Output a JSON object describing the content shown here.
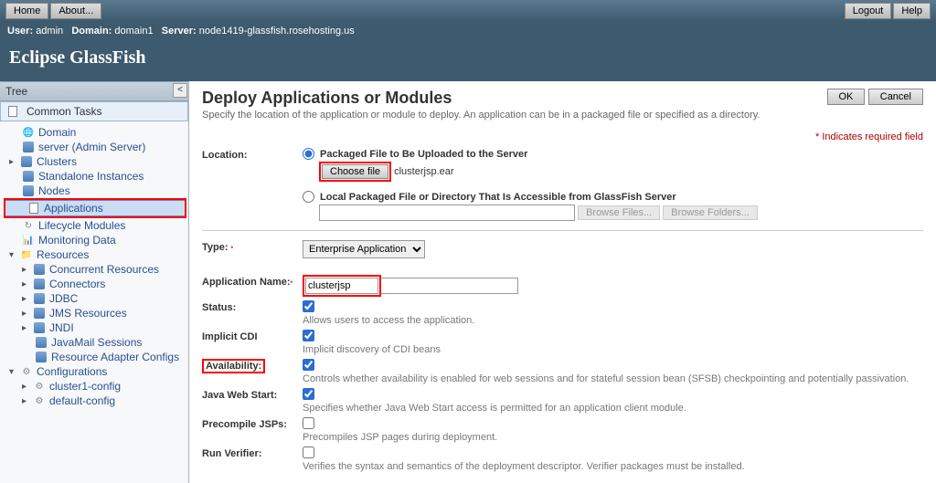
{
  "topbar": {
    "home": "Home",
    "about": "About...",
    "logout": "Logout",
    "help": "Help"
  },
  "infobar": {
    "user_lbl": "User:",
    "user_val": "admin",
    "domain_lbl": "Domain:",
    "domain_val": "domain1",
    "server_lbl": "Server:",
    "server_val": "node1419-glassfish.rosehosting.us"
  },
  "brand": "Eclipse GlassFish",
  "tree": {
    "title": "Tree",
    "common": "Common Tasks",
    "items": {
      "domain": "Domain",
      "server": "server (Admin Server)",
      "clusters": "Clusters",
      "standalone": "Standalone Instances",
      "nodes": "Nodes",
      "applications": "Applications",
      "lifecycle": "Lifecycle Modules",
      "monitoring": "Monitoring Data",
      "resources": "Resources",
      "concurrent": "Concurrent Resources",
      "connectors": "Connectors",
      "jdbc": "JDBC",
      "jms": "JMS Resources",
      "jndi": "JNDI",
      "javamail": "JavaMail Sessions",
      "rac": "Resource Adapter Configs",
      "configurations": "Configurations",
      "cluster1": "cluster1-config",
      "default": "default-config"
    }
  },
  "main": {
    "title": "Deploy Applications or Modules",
    "subtitle": "Specify the location of the application or module to deploy. An application can be in a packaged file or specified as a directory.",
    "ok": "OK",
    "cancel": "Cancel",
    "req": "Indicates required field",
    "location": "Location:",
    "packaged": "Packaged File to Be Uploaded to the Server",
    "choose": "Choose file",
    "filename": "clusterjsp.ear",
    "local": "Local Packaged File or Directory That Is Accessible from GlassFish Server",
    "browse_files": "Browse Files...",
    "browse_folders": "Browse Folders...",
    "type": "Type:",
    "type_val": "Enterprise Application",
    "appname": "Application Name:",
    "appname_val": "clusterjsp",
    "status": "Status:",
    "status_help": "Allows users to access the application.",
    "implicit": "Implicit CDI",
    "implicit_help": "Implicit discovery of CDI beans",
    "avail": "Availability:",
    "avail_help": "Controls whether availability is enabled for web sessions and for stateful session bean (SFSB) checkpointing and potentially passivation.",
    "jws": "Java Web Start:",
    "jws_help": "Specifies whether Java Web Start access is permitted for an application client module.",
    "precompile": "Precompile JSPs:",
    "precompile_help": "Precompiles JSP pages during deployment.",
    "verifier": "Run Verifier:",
    "verifier_help": "Verifies the syntax and semantics of the deployment descriptor. Verifier packages must be installed."
  }
}
